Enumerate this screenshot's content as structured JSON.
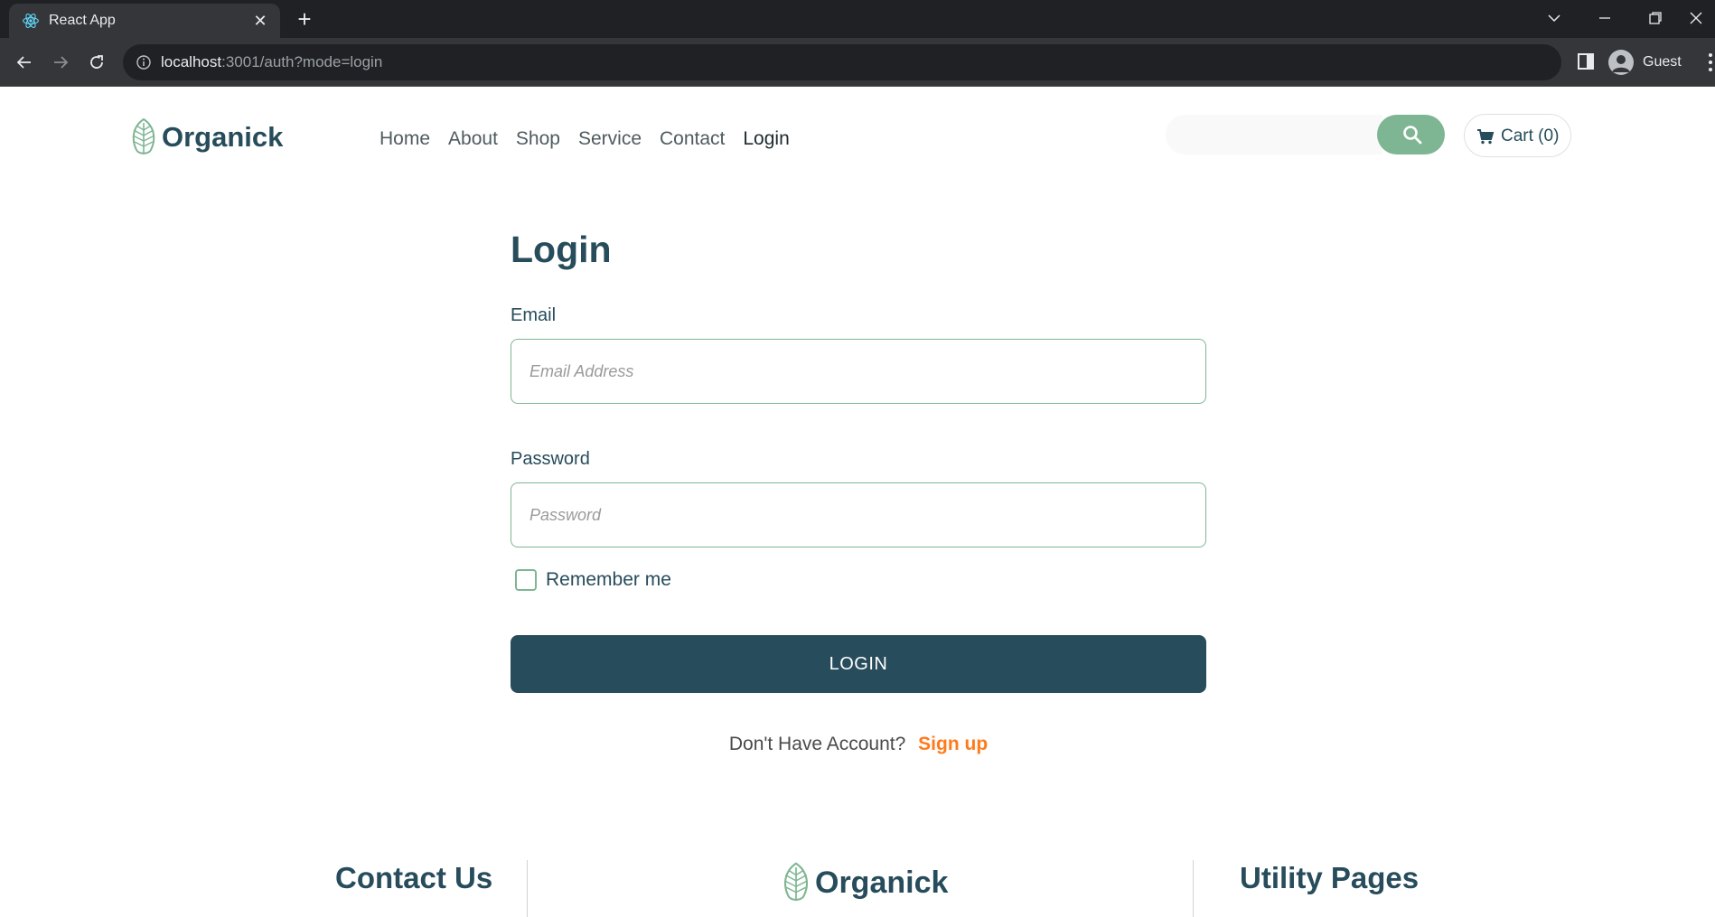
{
  "browser": {
    "tab": {
      "title": "React App"
    },
    "address": {
      "host": "localhost",
      "rest": ":3001/auth?mode=login"
    },
    "profile": {
      "label": "Guest"
    }
  },
  "header": {
    "logo_text": "Organick",
    "nav": [
      {
        "label": "Home",
        "active": false
      },
      {
        "label": "About",
        "active": false
      },
      {
        "label": "Shop",
        "active": false
      },
      {
        "label": "Service",
        "active": false
      },
      {
        "label": "Contact",
        "active": false
      },
      {
        "label": "Login",
        "active": true
      }
    ],
    "search": {
      "placeholder": "",
      "value": ""
    },
    "cart_label": "Cart (0)"
  },
  "form": {
    "title": "Login",
    "email": {
      "label": "Email",
      "placeholder": "Email Address",
      "value": ""
    },
    "password": {
      "label": "Password",
      "placeholder": "Password",
      "value": ""
    },
    "remember_label": "Remember me",
    "remember_checked": false,
    "submit_label": "LOGIN",
    "signup_prompt": "Don't Have Account?",
    "signup_link": "Sign up"
  },
  "footer": {
    "contact_heading": "Contact Us",
    "logo_text": "Organick",
    "utility_heading": "Utility Pages"
  },
  "colors": {
    "brand_dark": "#274c5b",
    "brand_green": "#7eb693",
    "accent_orange": "#ff7a1a"
  }
}
